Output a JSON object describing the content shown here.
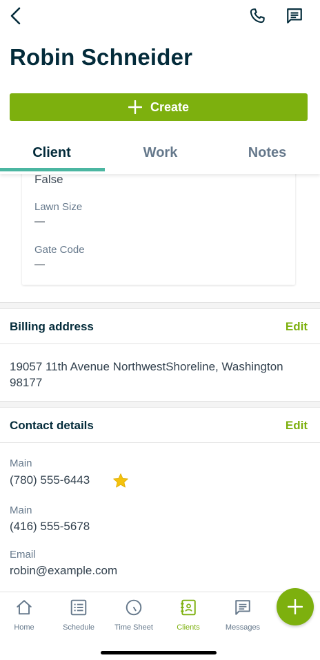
{
  "header": {
    "back_icon": "chevron-left-icon",
    "phone_icon": "phone-icon",
    "message_icon": "message-icon",
    "title": "Robin Schneider"
  },
  "create_button": {
    "label": "Create",
    "icon": "plus-icon"
  },
  "tabs": [
    {
      "label": "Client",
      "active": true
    },
    {
      "label": "Work",
      "active": false
    },
    {
      "label": "Notes",
      "active": false
    }
  ],
  "custom_fields": {
    "partial_value": "False",
    "fields": [
      {
        "label": "Lawn Size",
        "value": "—"
      },
      {
        "label": "Gate Code",
        "value": "—"
      }
    ]
  },
  "billing": {
    "title": "Billing address",
    "edit_label": "Edit",
    "address": "19057 11th Avenue NorthwestShoreline, Washington 98177"
  },
  "contact": {
    "title": "Contact details",
    "edit_label": "Edit",
    "items": [
      {
        "label": "Main",
        "value": "(780) 555-6443",
        "starred": true
      },
      {
        "label": "Main",
        "value": "(416) 555-5678",
        "starred": false
      },
      {
        "label": "Email",
        "value": "robin@example.com",
        "starred": false
      }
    ]
  },
  "bottom_nav": [
    {
      "label": "Home",
      "icon": "home-icon",
      "active": false
    },
    {
      "label": "Schedule",
      "icon": "schedule-icon",
      "active": false
    },
    {
      "label": "Time Sheet",
      "icon": "clock-icon",
      "active": false
    },
    {
      "label": "Clients",
      "icon": "clients-icon",
      "active": true
    },
    {
      "label": "Messages",
      "icon": "messages-icon",
      "active": false
    }
  ],
  "colors": {
    "brand_green": "#7db00e",
    "tab_indicator": "#4bb6a1",
    "heading": "#032b3a",
    "star": "#f4c20d"
  }
}
